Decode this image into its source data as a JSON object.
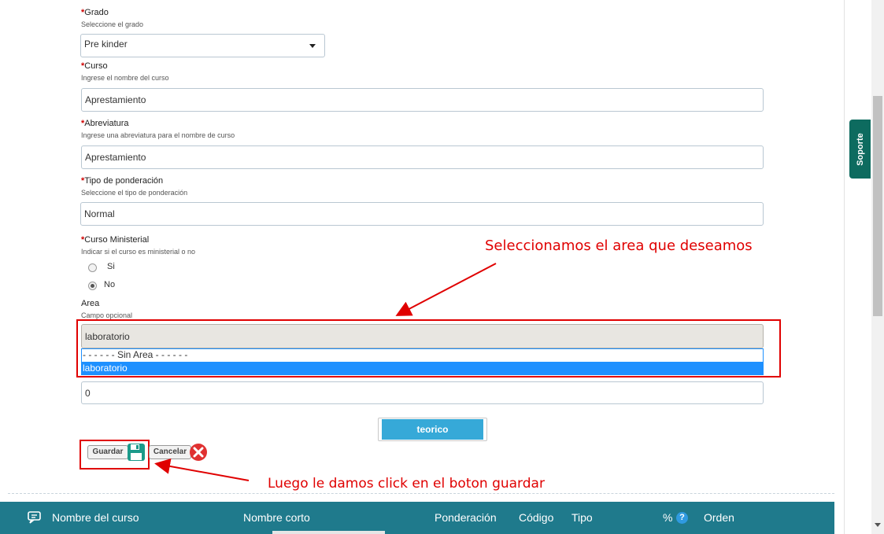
{
  "form": {
    "grado": {
      "required_mark": "*",
      "label": "Grado",
      "hint": "Seleccione el grado",
      "value": "Pre kinder"
    },
    "curso": {
      "required_mark": "*",
      "label": "Curso",
      "hint": "Ingrese el nombre del curso",
      "value": "Aprestamiento"
    },
    "abreviatura": {
      "required_mark": "*",
      "label": "Abreviatura",
      "hint": "Ingrese una abreviatura para el nombre de curso",
      "value": "Aprestamiento"
    },
    "tipo_ponderacion": {
      "required_mark": "*",
      "label": "Tipo de ponderación",
      "hint": "Seleccione el tipo de ponderación",
      "value": "Normal"
    },
    "curso_ministerial": {
      "required_mark": "*",
      "label": "Curso Ministerial",
      "hint": "Indicar si el curso es ministerial o no",
      "options": [
        "Si",
        "No"
      ],
      "selected": "No"
    },
    "area": {
      "label": "Area",
      "hint": "Campo opcional",
      "value": "laboratorio",
      "options": [
        "- - - - - - Sin Area - - - - - -",
        "laboratorio"
      ],
      "highlighted": "laboratorio"
    },
    "orden_value": "0",
    "tipo_button": "teorico",
    "save_label": "Guardar",
    "cancel_label": "Cancelar"
  },
  "annotations": {
    "select_area": "Seleccionamos el area que deseamos",
    "click_save": "Luego le damos click en el boton guardar"
  },
  "support_tab": "Soporte",
  "table_header": {
    "columns": [
      "Nombre del curso",
      "Nombre corto",
      "Ponderación",
      "Código",
      "Tipo",
      "%",
      "Orden"
    ]
  },
  "colors": {
    "annotation": "#e00000",
    "header_bg": "#1f7a8c",
    "selected_option": "#1e90ff",
    "teorico_btn": "#36a9d8"
  }
}
